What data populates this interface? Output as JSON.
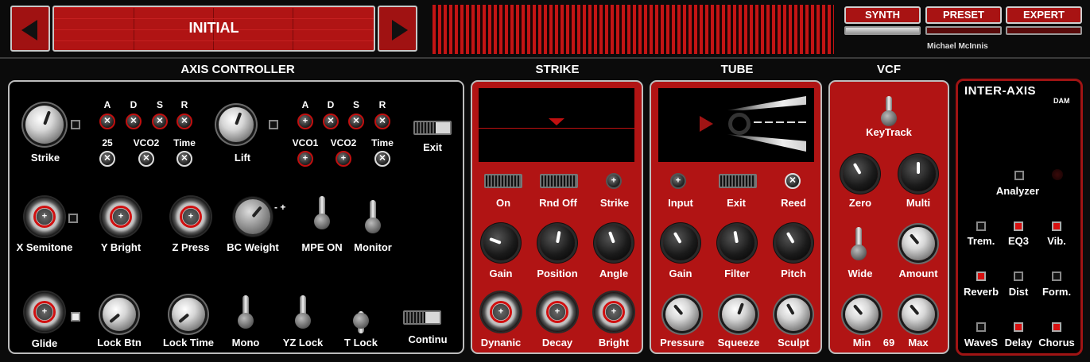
{
  "header": {
    "preset_name": "INITIAL",
    "prev_icon": "left-triangle",
    "next_icon": "right-triangle",
    "mode_buttons": [
      "SYNTH",
      "PRESET",
      "EXPERT"
    ],
    "active_mode": "SYNTH",
    "author": "Michael McInnis"
  },
  "sections": {
    "axis": "AXIS CONTROLLER",
    "strike": "STRIKE",
    "tube": "TUBE",
    "vcf": "VCF"
  },
  "axis": {
    "row1": {
      "strike": "Strike",
      "lift": "Lift",
      "exit": "Exit",
      "left_env": {
        "a": "A",
        "d": "D",
        "s": "S",
        "r": "R",
        "v25": "25",
        "vco2": "VCO2",
        "time": "Time"
      },
      "right_env": {
        "a": "A",
        "d": "D",
        "s": "S",
        "r": "R",
        "vco1": "VCO1",
        "vco2": "VCO2",
        "time": "Time"
      }
    },
    "row2": {
      "x_semitone": "X Semitone",
      "y_bright": "Y Bright",
      "z_press": "Z Press",
      "bc_weight": "BC Weight",
      "bc_range": "- +",
      "mpe_on": "MPE ON",
      "monitor": "Monitor"
    },
    "row3": {
      "glide": "Glide",
      "lock_btn": "Lock Btn",
      "lock_time": "Lock Time",
      "mono": "Mono",
      "yz_lock": "YZ Lock",
      "t_lock": "T Lock",
      "continu": "Continu"
    }
  },
  "strike": {
    "on": "On",
    "rnd_off": "Rnd Off",
    "strike": "Strike",
    "gain": "Gain",
    "position": "Position",
    "angle": "Angle",
    "dynanic": "Dynanic",
    "decay": "Decay",
    "bright": "Bright"
  },
  "tube": {
    "input": "Input",
    "exit": "Exit",
    "reed": "Reed",
    "gain": "Gain",
    "filter": "Filter",
    "pitch": "Pitch",
    "pressure": "Pressure",
    "squeeze": "Squeeze",
    "sculpt": "Sculpt"
  },
  "vcf": {
    "keytrack": "KeyTrack",
    "zero": "Zero",
    "multi": "Multi",
    "wide": "Wide",
    "amount": "Amount",
    "min": "Min",
    "value": "69",
    "max": "Max"
  },
  "fx": {
    "logo": "INTER-AXIS",
    "logo_sub": "DAM",
    "analyzer": "Analyzer",
    "items": [
      {
        "label": "Trem.",
        "on": false
      },
      {
        "label": "EQ3",
        "on": true
      },
      {
        "label": "Vib.",
        "on": true
      },
      {
        "label": "Reverb",
        "on": true
      },
      {
        "label": "Dist",
        "on": false
      },
      {
        "label": "Form.",
        "on": false
      },
      {
        "label": "WaveS",
        "on": false
      },
      {
        "label": "Delay",
        "on": true
      },
      {
        "label": "Chorus",
        "on": true
      }
    ]
  },
  "colors": {
    "accent_red": "#b11414",
    "background": "#0b0b0b",
    "panel_border": "#bdbdbd"
  }
}
